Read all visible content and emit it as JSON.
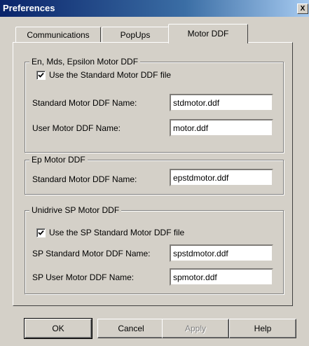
{
  "window": {
    "title": "Preferences",
    "close_glyph": "X"
  },
  "tabs": [
    {
      "label": "Communications",
      "active": false
    },
    {
      "label": "PopUps",
      "active": false
    },
    {
      "label": "Motor DDF",
      "active": true
    }
  ],
  "group_emds": {
    "legend": "En, Mds, Epsilon Motor DDF",
    "checkbox_label": "Use the Standard Motor DDF file",
    "checked": true,
    "standard_label": "Standard Motor DDF Name:",
    "standard_value": "stdmotor.ddf",
    "user_label": "User Motor DDF Name:",
    "user_value": "motor.ddf"
  },
  "group_ep": {
    "legend": "Ep Motor DDF",
    "standard_label": "Standard Motor DDF Name:",
    "standard_value": "epstdmotor.ddf"
  },
  "group_sp": {
    "legend": "Unidrive SP Motor DDF",
    "checkbox_label": "Use the SP Standard Motor DDF file",
    "checked": true,
    "standard_label": "SP Standard Motor DDF Name:",
    "standard_value": "spstdmotor.ddf",
    "user_label": "SP User Motor DDF Name:",
    "user_value": "spmotor.ddf"
  },
  "buttons": {
    "ok": "OK",
    "cancel": "Cancel",
    "apply": "Apply",
    "help": "Help"
  }
}
